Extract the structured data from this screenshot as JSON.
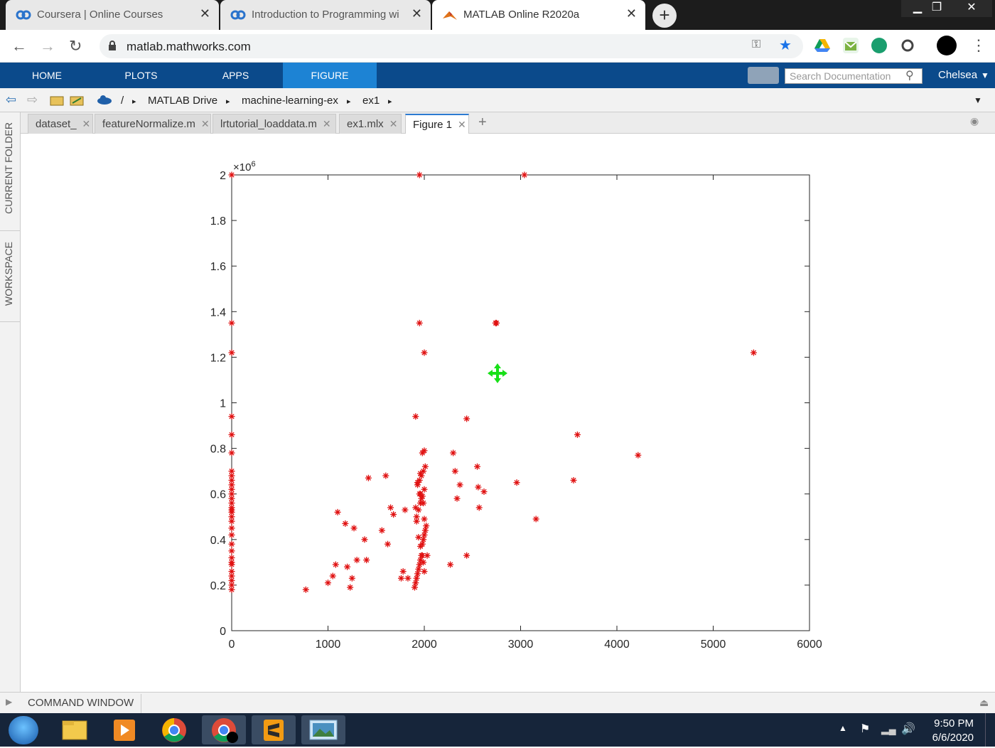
{
  "browser": {
    "tabs": [
      {
        "title": "Coursera | Online Courses & Cre",
        "favicon": "coursera-icon"
      },
      {
        "title": "Introduction to Programming wi",
        "favicon": "coursera-icon"
      },
      {
        "title": "MATLAB Online R2020a",
        "favicon": "matlab-icon"
      }
    ],
    "new_tab": "+",
    "url": "matlab.mathworks.com"
  },
  "ribbon": {
    "tabs": [
      "HOME",
      "PLOTS",
      "APPS",
      "FIGURE"
    ],
    "active_tab": "FIGURE",
    "search_placeholder": "Search Documentation",
    "user": "Chelsea"
  },
  "path": {
    "root": "/",
    "crumbs": [
      "MATLAB Drive",
      "machine-learning-ex",
      "ex1"
    ]
  },
  "sidebar": {
    "current_folder": "CURRENT FOLDER",
    "workspace": "WORKSPACE"
  },
  "doc_tabs": [
    "dataset_",
    "featureNormalize.m",
    "lrtutorial_loaddata.m",
    "ex1.mlx",
    "Figure 1"
  ],
  "active_doc_tab": "Figure 1",
  "command_window": "COMMAND WINDOW",
  "taskbar": {
    "time": "9:50 PM",
    "date": "6/6/2020"
  },
  "chart_data": {
    "type": "scatter",
    "marker": "*",
    "color": "#e01010",
    "xlim": [
      0,
      6000
    ],
    "ylim": [
      0,
      2000000
    ],
    "xticks": [
      0,
      1000,
      2000,
      3000,
      4000,
      5000,
      6000
    ],
    "yticks": [
      0,
      0.2,
      0.4,
      0.6,
      0.8,
      1,
      1.2,
      1.4,
      1.6,
      1.8,
      2
    ],
    "y_exponent": "×10",
    "y_exponent_power": "6",
    "x": [
      0,
      0,
      0,
      0,
      0,
      0,
      0,
      0,
      0,
      0,
      0,
      0,
      0,
      0,
      0,
      0,
      0,
      0,
      0,
      0,
      0,
      0,
      0,
      0,
      0,
      0,
      0,
      0,
      0,
      0,
      0,
      770,
      1000,
      1050,
      1080,
      1180,
      1200,
      1230,
      1250,
      1270,
      1300,
      1100,
      1380,
      1400,
      1420,
      1560,
      1600,
      1620,
      1650,
      1680,
      1760,
      1780,
      1800,
      1830,
      1900,
      1910,
      1920,
      1930,
      1940,
      1950,
      1960,
      1970,
      1980,
      1990,
      2000,
      2010,
      2020,
      1920,
      1940,
      1960,
      1980,
      2000,
      1930,
      1950,
      1970,
      1990,
      2010,
      1910,
      1920,
      1940,
      1960,
      1980,
      1990,
      2000,
      2030,
      1950,
      1970,
      1990,
      2000,
      1930,
      1960,
      1980,
      2000,
      1910,
      1950,
      2270,
      2300,
      2320,
      2340,
      2370,
      2440,
      2440,
      2550,
      2560,
      2570,
      2620,
      2750,
      2960,
      3160,
      3550,
      3590,
      4220,
      5420,
      1950,
      2000,
      2740,
      1960,
      3040
    ],
    "y": [
      180000,
      200000,
      220000,
      240000,
      260000,
      290000,
      320000,
      350000,
      380000,
      420000,
      450000,
      480000,
      500000,
      520000,
      530000,
      540000,
      560000,
      580000,
      600000,
      620000,
      640000,
      660000,
      680000,
      700000,
      780000,
      860000,
      940000,
      1220000,
      1350000,
      2000000,
      300000,
      180000,
      210000,
      240000,
      290000,
      470000,
      280000,
      190000,
      230000,
      450000,
      310000,
      520000,
      400000,
      310000,
      670000,
      440000,
      680000,
      380000,
      540000,
      510000,
      230000,
      260000,
      530000,
      230000,
      190000,
      210000,
      230000,
      250000,
      270000,
      290000,
      310000,
      330000,
      380000,
      400000,
      420000,
      440000,
      460000,
      500000,
      530000,
      560000,
      590000,
      620000,
      640000,
      660000,
      680000,
      700000,
      720000,
      540000,
      480000,
      410000,
      370000,
      330000,
      300000,
      260000,
      330000,
      600000,
      580000,
      560000,
      490000,
      650000,
      690000,
      780000,
      790000,
      940000,
      1350000,
      290000,
      780000,
      700000,
      580000,
      640000,
      930000,
      330000,
      720000,
      630000,
      540000,
      610000,
      1350000,
      650000,
      490000,
      660000,
      860000,
      770000,
      1220000,
      2000000,
      1220000,
      1350000,
      600000,
      2000000
    ]
  }
}
